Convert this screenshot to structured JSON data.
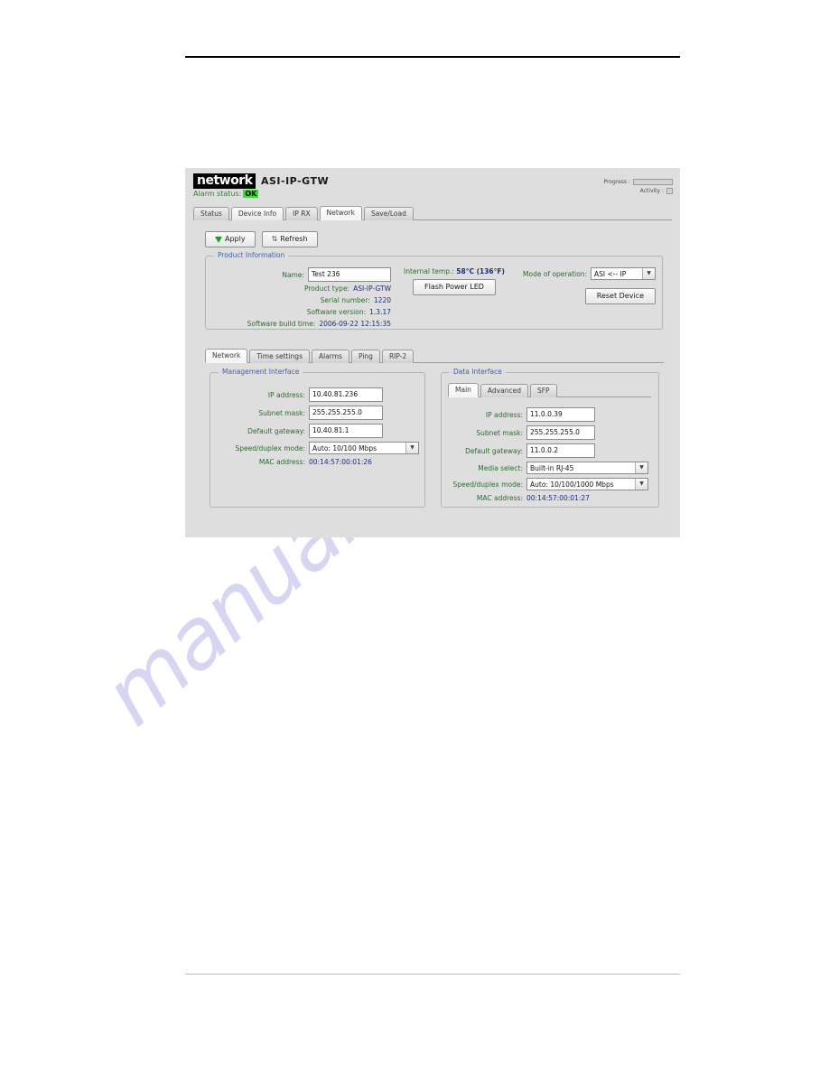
{
  "header": {
    "brand_logo": "network",
    "product_title": "ASI-IP-GTW",
    "alarm_label": "Alarm status:",
    "alarm_value": "OK",
    "progress_label": "Progress :",
    "activity_label": "Activity :"
  },
  "main_tabs": [
    {
      "label": "Status",
      "state": "normal"
    },
    {
      "label": "Device Info",
      "state": "hilite"
    },
    {
      "label": "IP RX",
      "state": "normal"
    },
    {
      "label": "Network",
      "state": "active"
    },
    {
      "label": "Save/Load",
      "state": "normal"
    }
  ],
  "actions": {
    "apply_label": "Apply",
    "refresh_label": "Refresh",
    "refresh_icon": "recycle-icon",
    "apply_icon": "green-chevron-down-icon"
  },
  "product_information": {
    "title": "Product Information",
    "name_label": "Name:",
    "name_value": "Test 236",
    "rows": [
      {
        "label": "Product type:",
        "value": "ASI-IP-GTW"
      },
      {
        "label": "Serial number:",
        "value": "1220"
      },
      {
        "label": "Software version:",
        "value": "1.3.17"
      },
      {
        "label": "Software build time:",
        "value": "2006-09-22 12:15:35"
      }
    ],
    "temp_label": "Internal temp.:",
    "temp_value": "58°C (136°F)",
    "flash_led_label": "Flash Power LED",
    "mode_label": "Mode of operation:",
    "mode_value": "ASI <-- IP",
    "reset_label": "Reset Device"
  },
  "sub_tabs": [
    {
      "label": "Network",
      "state": "active"
    },
    {
      "label": "Time settings",
      "state": "normal"
    },
    {
      "label": "Alarms",
      "state": "normal"
    },
    {
      "label": "Ping",
      "state": "normal"
    },
    {
      "label": "RIP-2",
      "state": "normal"
    }
  ],
  "management_interface": {
    "title": "Management Interface",
    "fields": [
      {
        "label": "IP address:",
        "value": "10.40.81.236",
        "type": "text"
      },
      {
        "label": "Subnet mask:",
        "value": "255.255.255.0",
        "type": "text"
      },
      {
        "label": "Default gateway:",
        "value": "10.40.81.1",
        "type": "text"
      },
      {
        "label": "Speed/duplex mode:",
        "value": "Auto: 10/100 Mbps",
        "type": "select"
      },
      {
        "label": "MAC address:",
        "value": "00:14:57:00:01:26",
        "type": "static"
      }
    ]
  },
  "data_interface": {
    "title": "Data Interface",
    "tabs": [
      {
        "label": "Main",
        "state": "active"
      },
      {
        "label": "Advanced",
        "state": "normal"
      },
      {
        "label": "SFP",
        "state": "normal"
      }
    ],
    "fields": [
      {
        "label": "IP address:",
        "value": "11.0.0.39",
        "type": "text"
      },
      {
        "label": "Subnet mask:",
        "value": "255.255.255.0",
        "type": "text"
      },
      {
        "label": "Default gateway:",
        "value": "11.0.0.2",
        "type": "text"
      },
      {
        "label": "Media select:",
        "value": "Built-in RJ-45",
        "type": "select"
      },
      {
        "label": "Speed/duplex mode:",
        "value": "Auto: 10/100/1000 Mbps",
        "type": "select"
      },
      {
        "label": "MAC address:",
        "value": "00:14:57:00:01:27",
        "type": "static"
      }
    ]
  },
  "watermark": {
    "text": "manualshive.com"
  },
  "colors": {
    "panel_bg": "#dededf",
    "label_green": "#2e6b2e",
    "value_navy": "#1c2f7a",
    "group_title_blue": "#3a5fb0",
    "alarm_ok_green": "#33e033",
    "watermark_purple": "#c9c9ee"
  }
}
